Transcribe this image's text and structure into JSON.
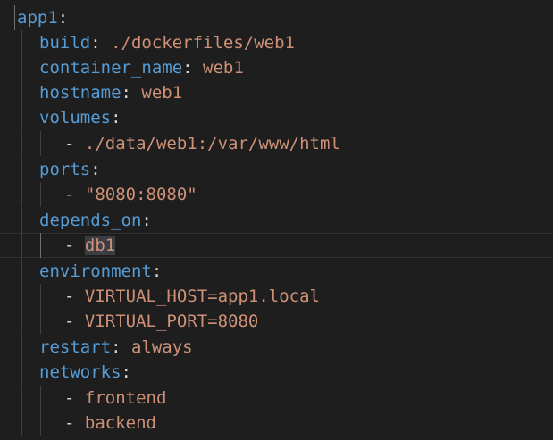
{
  "lines": [
    {
      "key": "app1",
      "sep": ":",
      "value": ""
    },
    {
      "key": "build",
      "sep": ": ",
      "value": "./dockerfiles/web1"
    },
    {
      "key": "container_name",
      "sep": ": ",
      "value": "web1"
    },
    {
      "key": "hostname",
      "sep": ": ",
      "value": "web1"
    },
    {
      "key": "volumes",
      "sep": ":",
      "value": ""
    },
    {
      "dash": "- ",
      "item": "./data/web1:/var/www/html"
    },
    {
      "key": "ports",
      "sep": ":",
      "value": ""
    },
    {
      "dash": "- ",
      "item": "\"8080:8080\""
    },
    {
      "key": "depends_on",
      "sep": ":",
      "value": ""
    },
    {
      "dash": "- ",
      "item": "db1"
    },
    {
      "key": "environment",
      "sep": ":",
      "value": ""
    },
    {
      "dash": "- ",
      "item": "VIRTUAL_HOST=app1.local"
    },
    {
      "dash": "- ",
      "item": "VIRTUAL_PORT=8080"
    },
    {
      "key": "restart",
      "sep": ": ",
      "value": "always"
    },
    {
      "key": "networks",
      "sep": ":",
      "value": ""
    },
    {
      "dash": "- ",
      "item": "frontend"
    },
    {
      "dash": "- ",
      "item": "backend"
    }
  ],
  "colors": {
    "background": "#1e1e1e",
    "key": "#569cd6",
    "string": "#ce9178",
    "punctuation": "#d4d4d4",
    "indent_guide": "#404040",
    "selection_highlight": "#3a3d41"
  }
}
